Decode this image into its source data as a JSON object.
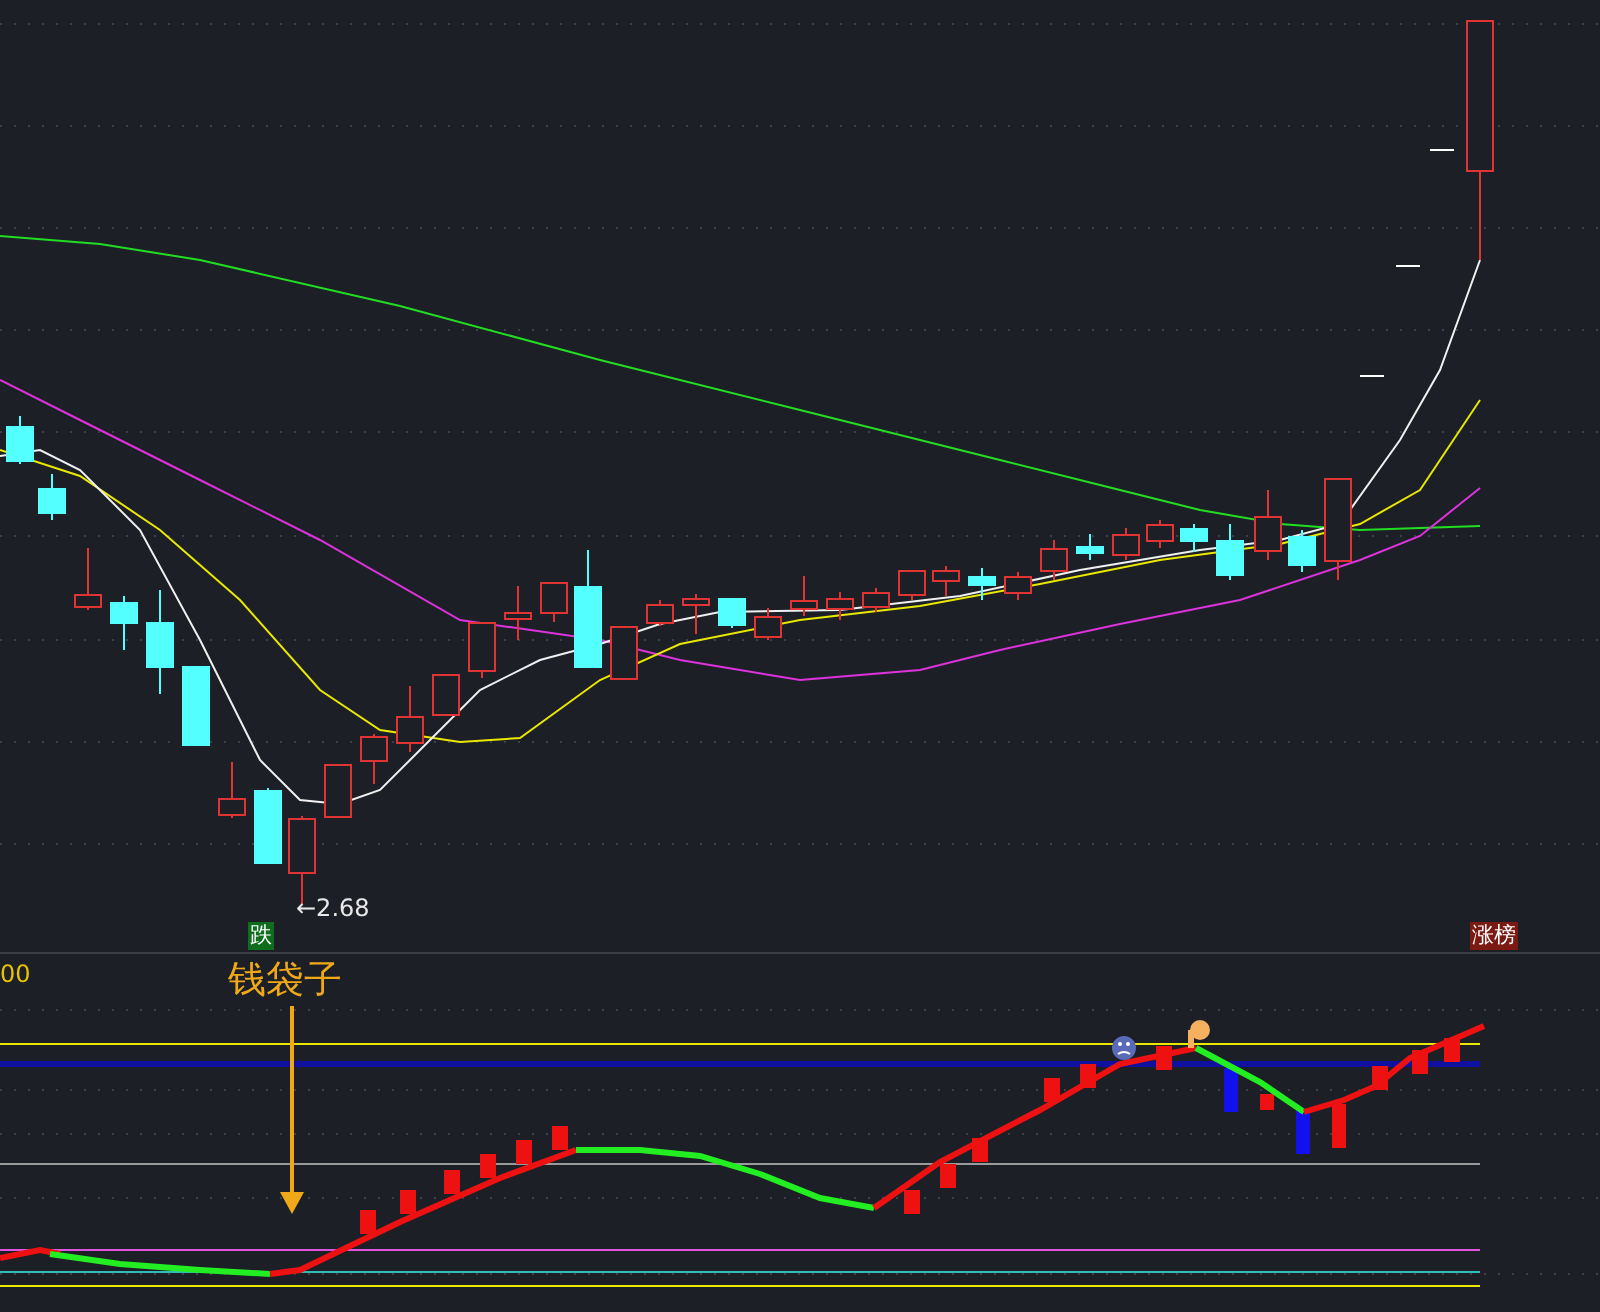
{
  "price_chart": {
    "low_label": "←2.68"
  },
  "signal_badge": {
    "text": "跌"
  },
  "rank_badge": {
    "text": "涨榜"
  },
  "indicator": {
    "axis_value": "00",
    "name": "钱袋子"
  }
}
